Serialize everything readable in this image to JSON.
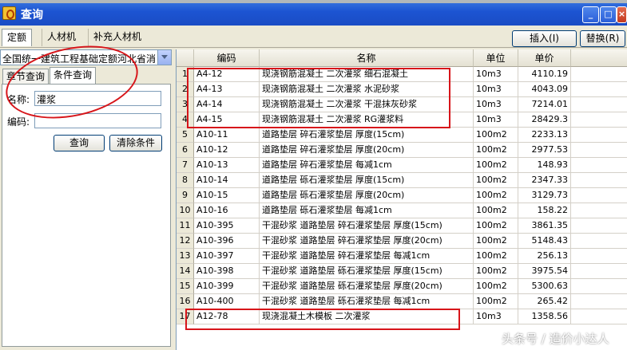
{
  "window": {
    "title": "查询"
  },
  "tabs": [
    "定额",
    "人材机",
    "补充人材机"
  ],
  "toolbar": {
    "insert": "插入(I)",
    "replace": "替换(R)"
  },
  "left": {
    "combo": "全国统一建筑工程基础定额河北省消",
    "subtabs": [
      "章节查询",
      "条件查询"
    ],
    "name_label": "名称:",
    "name_value": "灌浆",
    "code_label": "编码:",
    "code_value": "",
    "query_btn": "查询",
    "clear_btn": "清除条件"
  },
  "grid": {
    "columns": [
      "编码",
      "名称",
      "单位",
      "单价"
    ],
    "rows": [
      {
        "n": "1",
        "code": "A4-12",
        "name": "现浇钢筋混凝土 二次灌浆 细石混凝土",
        "unit": "10m3",
        "price": "4110.19"
      },
      {
        "n": "2",
        "code": "A4-13",
        "name": "现浇钢筋混凝土 二次灌浆 水泥砂浆",
        "unit": "10m3",
        "price": "4043.09"
      },
      {
        "n": "3",
        "code": "A4-14",
        "name": "现浇钢筋混凝土 二次灌浆 干混抹灰砂浆",
        "unit": "10m3",
        "price": "7214.01"
      },
      {
        "n": "4",
        "code": "A4-15",
        "name": "现浇钢筋混凝土 二次灌浆 RG灌浆料",
        "unit": "10m3",
        "price": "28429.3"
      },
      {
        "n": "5",
        "code": "A10-11",
        "name": "道路垫层 碎石灌浆垫层 厚度(15cm)",
        "unit": "100m2",
        "price": "2233.13"
      },
      {
        "n": "6",
        "code": "A10-12",
        "name": "道路垫层 碎石灌浆垫层 厚度(20cm)",
        "unit": "100m2",
        "price": "2977.53"
      },
      {
        "n": "7",
        "code": "A10-13",
        "name": "道路垫层 碎石灌浆垫层 每减1cm",
        "unit": "100m2",
        "price": "148.93"
      },
      {
        "n": "8",
        "code": "A10-14",
        "name": "道路垫层 砾石灌浆垫层 厚度(15cm)",
        "unit": "100m2",
        "price": "2347.33"
      },
      {
        "n": "9",
        "code": "A10-15",
        "name": "道路垫层 砾石灌浆垫层 厚度(20cm)",
        "unit": "100m2",
        "price": "3129.73"
      },
      {
        "n": "10",
        "code": "A10-16",
        "name": "道路垫层 砾石灌浆垫层 每减1cm",
        "unit": "100m2",
        "price": "158.22"
      },
      {
        "n": "11",
        "code": "A10-395",
        "name": "干混砂浆 道路垫层 碎石灌浆垫层 厚度(15cm)",
        "unit": "100m2",
        "price": "3861.35"
      },
      {
        "n": "12",
        "code": "A10-396",
        "name": "干混砂浆 道路垫层 碎石灌浆垫层 厚度(20cm)",
        "unit": "100m2",
        "price": "5148.43"
      },
      {
        "n": "13",
        "code": "A10-397",
        "name": "干混砂浆 道路垫层 碎石灌浆垫层 每减1cm",
        "unit": "100m2",
        "price": "256.13"
      },
      {
        "n": "14",
        "code": "A10-398",
        "name": "干混砂浆 道路垫层 砾石灌浆垫层 厚度(15cm)",
        "unit": "100m2",
        "price": "3975.54"
      },
      {
        "n": "15",
        "code": "A10-399",
        "name": "干混砂浆 道路垫层 砾石灌浆垫层 厚度(20cm)",
        "unit": "100m2",
        "price": "5300.63"
      },
      {
        "n": "16",
        "code": "A10-400",
        "name": "干混砂浆 道路垫层 砾石灌浆垫层 每减1cm",
        "unit": "100m2",
        "price": "265.42"
      },
      {
        "n": "17",
        "code": "A12-78",
        "name": "现浇混凝土木模板 二次灌浆",
        "unit": "10m3",
        "price": "1358.56"
      }
    ]
  },
  "watermark": "头条号 / 造价小达人",
  "colors": {
    "annotation": "#d7151a",
    "titlebar": "#1c54d2"
  }
}
